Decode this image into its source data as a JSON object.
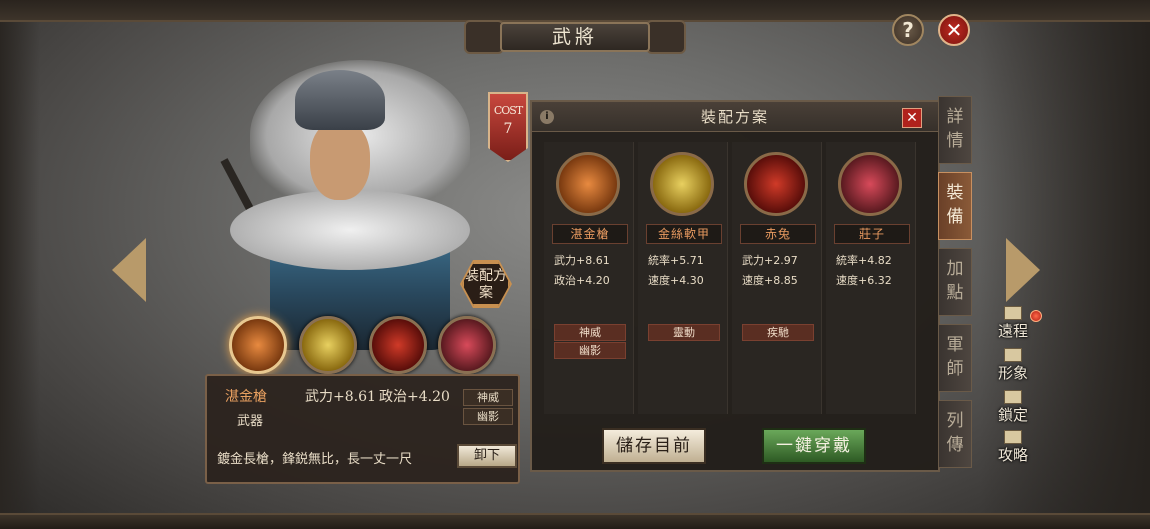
{
  "header": {
    "title": "武將"
  },
  "hero": {
    "cost_label": "COST",
    "cost_value": "7",
    "loadout_button": "裝配方案"
  },
  "equip_slots": [
    {
      "name": "湛金槍",
      "icon": "spear-icon"
    },
    {
      "name": "金絲軟甲",
      "icon": "armor-icon"
    },
    {
      "name": "赤兔",
      "icon": "horse-icon"
    },
    {
      "name": "莊子",
      "icon": "book-icon"
    }
  ],
  "selected_item": {
    "name": "湛金槍",
    "stat1": "武力+8.61",
    "stat2": "政治+4.20",
    "type": "武器",
    "skills": [
      "神威",
      "幽影"
    ],
    "description": "鍍金長槍，鋒鋭無比，長一丈一尺",
    "unequip_label": "卸下"
  },
  "panel": {
    "title": "裝配方案",
    "columns": [
      {
        "name": "湛金槍",
        "stats": [
          "武力+8.61",
          "政治+4.20"
        ],
        "skills": [
          "神威",
          "幽影"
        ]
      },
      {
        "name": "金絲軟甲",
        "stats": [
          "統率+5.71",
          "速度+4.30"
        ],
        "skills": [
          "靈動"
        ]
      },
      {
        "name": "赤兔",
        "stats": [
          "武力+2.97",
          "速度+8.85"
        ],
        "skills": [
          "疾馳"
        ]
      },
      {
        "name": "莊子",
        "stats": [
          "統率+4.82",
          "速度+6.32"
        ],
        "skills": []
      }
    ],
    "save_label": "儲存目前",
    "equip_all_label": "一鍵穿戴"
  },
  "tabs": [
    "詳情",
    "裝備",
    "加點",
    "軍師",
    "列傳"
  ],
  "active_tab": 1,
  "side_menu": [
    "遠程",
    "形象",
    "鎖定",
    "攻略"
  ]
}
